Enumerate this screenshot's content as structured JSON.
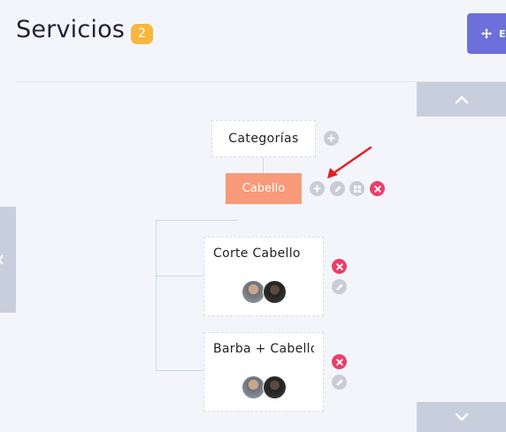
{
  "header": {
    "title": "Servicios",
    "count": "2",
    "action_label": "E"
  },
  "tree": {
    "root_label": "Categorías",
    "category_label": "Cabello",
    "services": [
      {
        "name": "Corte Cabello"
      },
      {
        "name": "Barba + Cabello"
      }
    ]
  },
  "colors": {
    "accent": "#6c6fdc",
    "category": "#f99a7a",
    "badge": "#f6b73c",
    "danger": "#ec3d6a",
    "annotation_arrow": "#e81d1d"
  },
  "icons": {
    "top_action": "move-icon",
    "scroll_up": "chevron-up-icon",
    "scroll_down": "chevron-down-icon",
    "add": "plus-icon",
    "edit": "pencil-icon",
    "assign": "grid-icon",
    "delete": "close-icon"
  }
}
